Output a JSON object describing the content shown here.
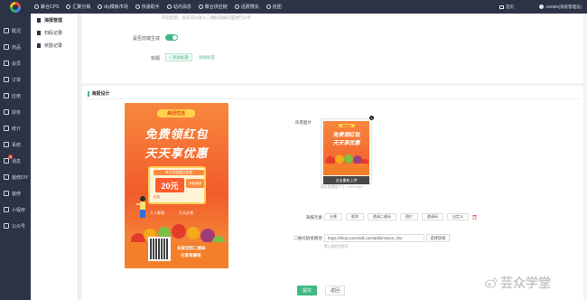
{
  "topbar": {
    "nav": [
      "聚合CPS",
      "汇聚分销",
      "diy模板市场",
      "快速助手",
      "站内消息",
      "聚合供应链",
      "话费慢充",
      "抢团"
    ],
    "home": "首页",
    "user": "ADMIN(系统管理员)"
  },
  "sidebar": {
    "items": [
      "概况",
      "商品",
      "会员",
      "订单",
      "应用",
      "财务",
      "统计",
      "系统",
      "消息",
      "装修DIY",
      "装修",
      "小程序",
      "公众号"
    ],
    "badge": "4"
  },
  "submenu": {
    "items": [
      "海报管理",
      "扫码记录",
      "奖励记录"
    ]
  },
  "settings": {
    "top_hint": "开启后后，会员可以进入二维码海报页面进行分享",
    "auto_gen_label": "是否前端生成",
    "title_label": "标题",
    "title_btn": "+ 添加标题",
    "title_link": "添加标签"
  },
  "poster_section": {
    "title": "海报设计",
    "poster": {
      "brand": "美团优选",
      "headline1": "免费领红包",
      "headline2": "天天享优惠",
      "coupon_tag": "每日送超额红包券",
      "coupon_value": "20元",
      "coupon_side": "消费满减",
      "coupon_foot": "红包",
      "sub1": "人人都领",
      "sub2": "天天必领",
      "slogan1": "长按识别二维码",
      "slogan2": "分享再赚钱"
    },
    "bg_label": "背景图片",
    "thumb": {
      "brand": "美团优选",
      "headline1": "免费领红包",
      "headline2": "天天享优惠",
      "reupload": "点击重新上传",
      "close": "×"
    },
    "thumb_hint": "建议背景图尺寸：640*1080",
    "elements_label": "海报元素",
    "elements": [
      "头像",
      "昵称",
      "邀请二维码",
      "图片",
      "邀请码",
      "自定义"
    ],
    "link_label": "二维码链接路径",
    "link_value": "https://shop.yunzmall.com/addons/yun_sho",
    "link_button": "选择链接",
    "link_hint": "默认跳转到首页",
    "submit": "提交",
    "back": "返回"
  },
  "watermark": "芸众学堂",
  "colors": {
    "sidebar_bg": "#2c3346",
    "accent": "#3fb984",
    "poster_orange": "#f25c2c"
  }
}
